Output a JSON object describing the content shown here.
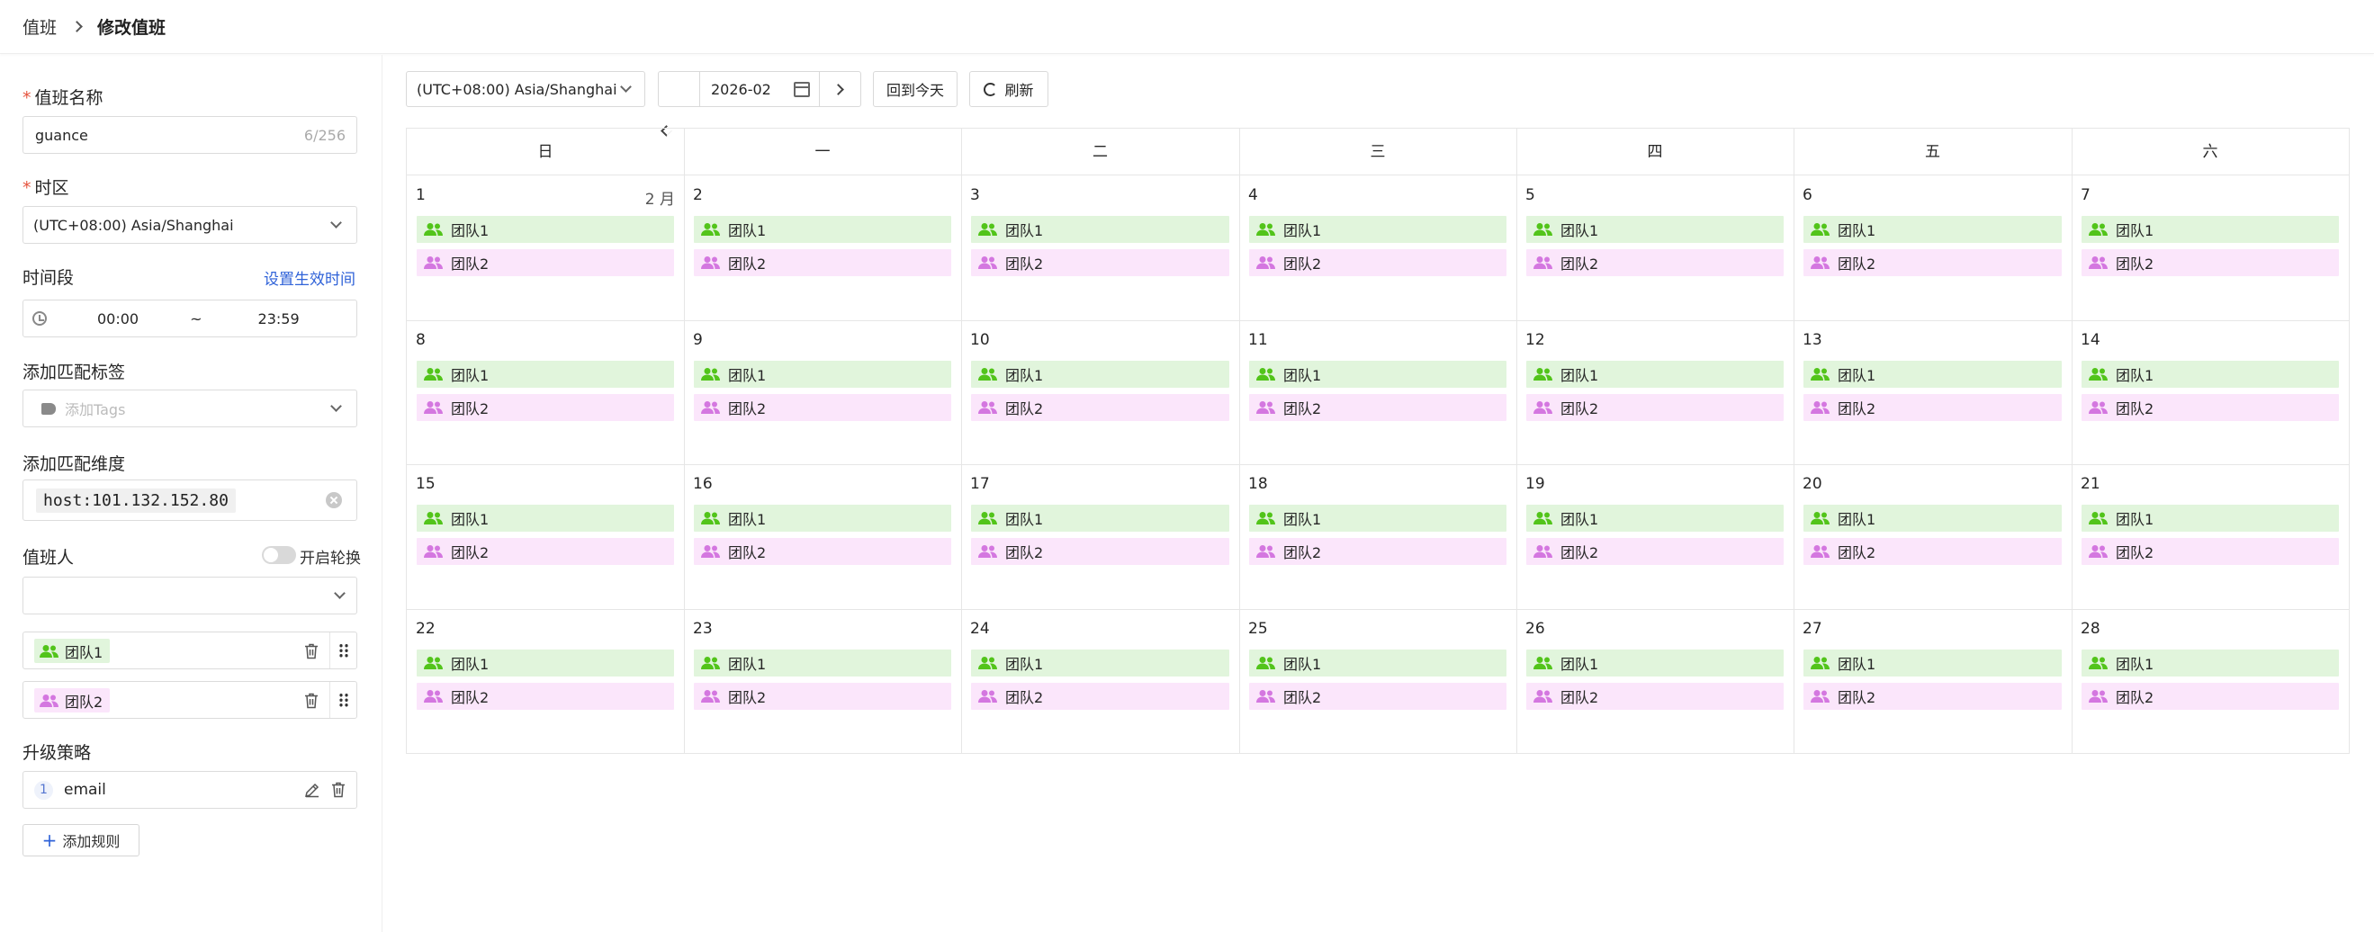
{
  "breadcrumb": {
    "parent": "值班",
    "current": "修改值班"
  },
  "form": {
    "name_label": "值班名称",
    "name_value": "guance",
    "name_count": "6/256",
    "timezone_label": "时区",
    "timezone_value": "(UTC+08:00) Asia/Shanghai",
    "period_label": "时间段",
    "period_link": "设置生效时间",
    "start_time": "00:00",
    "time_sep": "~",
    "end_time": "23:59",
    "tags_label": "添加匹配标签",
    "tags_placeholder": "添加Tags",
    "dimension_label": "添加匹配维度",
    "dimension_value": "host:101.132.152.80",
    "oncall_label": "值班人",
    "rotation_label": "开启轮换",
    "rotation_on": false,
    "teams": [
      {
        "name": "团队1",
        "color": "#52c41a",
        "bg": "#e1f5dc"
      },
      {
        "name": "团队2",
        "color": "#d477e0",
        "bg": "#fbe6fb"
      }
    ],
    "escalation_label": "升级策略",
    "rules": [
      {
        "index": "1",
        "name": "email"
      }
    ],
    "add_rule_label": "添加规则"
  },
  "toolbar": {
    "timezone": "(UTC+08:00) Asia/Shanghai",
    "month": "2026-02",
    "today_label": "回到今天",
    "refresh_label": "刷新"
  },
  "calendar": {
    "weekdays": [
      "日",
      "一",
      "二",
      "三",
      "四",
      "五",
      "六"
    ],
    "month_marker": "2 月",
    "weeks": [
      [
        "1",
        "2",
        "3",
        "4",
        "5",
        "6",
        "7"
      ],
      [
        "8",
        "9",
        "10",
        "11",
        "12",
        "13",
        "14"
      ],
      [
        "15",
        "16",
        "17",
        "18",
        "19",
        "20",
        "21"
      ],
      [
        "22",
        "23",
        "24",
        "25",
        "26",
        "27",
        "28"
      ]
    ],
    "events": [
      "团队1",
      "团队2"
    ]
  }
}
